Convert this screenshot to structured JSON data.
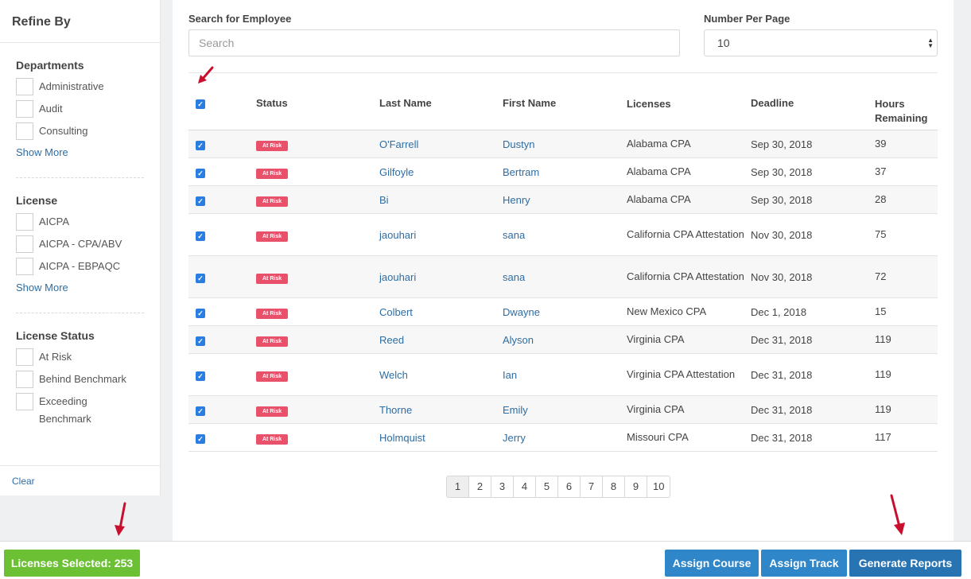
{
  "sidebar": {
    "title": "Refine By",
    "departments": {
      "title": "Departments",
      "options": [
        "Administrative",
        "Audit",
        "Consulting"
      ],
      "show_more": "Show More"
    },
    "license": {
      "title": "License",
      "options": [
        "AICPA",
        "AICPA - CPA/ABV",
        "AICPA - EBPAQC"
      ],
      "show_more": "Show More"
    },
    "license_status": {
      "title": "License Status",
      "options": [
        "At Risk",
        "Behind Benchmark",
        "Exceeding Benchmark"
      ]
    },
    "clear": "Clear"
  },
  "search": {
    "label": "Search for Employee",
    "placeholder": "Search",
    "value": ""
  },
  "per_page": {
    "label": "Number Per Page",
    "value": "10"
  },
  "table": {
    "headers": {
      "status": "Status",
      "last_name": "Last Name",
      "first_name": "First Name",
      "licenses": "Licenses",
      "deadline": "Deadline",
      "hours": "Hours Remaining"
    },
    "rows": [
      {
        "status": "At Risk",
        "last": "O'Farrell",
        "first": "Dustyn",
        "license": "Alabama CPA",
        "deadline": "Sep 30, 2018",
        "hours": "39"
      },
      {
        "status": "At Risk",
        "last": "Gilfoyle",
        "first": "Bertram",
        "license": "Alabama CPA",
        "deadline": "Sep 30, 2018",
        "hours": "37"
      },
      {
        "status": "At Risk",
        "last": "Bi",
        "first": "Henry",
        "license": "Alabama CPA",
        "deadline": "Sep 30, 2018",
        "hours": "28"
      },
      {
        "status": "At Risk",
        "last": "jaouhari",
        "first": "sana",
        "license": "California CPA Attestation",
        "deadline": "Nov 30, 2018",
        "hours": "75"
      },
      {
        "status": "At Risk",
        "last": "jaouhari",
        "first": "sana",
        "license": "California CPA Attestation",
        "deadline": "Nov 30, 2018",
        "hours": "72"
      },
      {
        "status": "At Risk",
        "last": "Colbert",
        "first": "Dwayne",
        "license": "New Mexico CPA",
        "deadline": "Dec 1, 2018",
        "hours": "15"
      },
      {
        "status": "At Risk",
        "last": "Reed",
        "first": "Alyson",
        "license": "Virginia CPA",
        "deadline": "Dec 31, 2018",
        "hours": "119"
      },
      {
        "status": "At Risk",
        "last": "Welch",
        "first": "Ian",
        "license": "Virginia CPA Attestation",
        "deadline": "Dec 31, 2018",
        "hours": "119"
      },
      {
        "status": "At Risk",
        "last": "Thorne",
        "first": "Emily",
        "license": "Virginia CPA",
        "deadline": "Dec 31, 2018",
        "hours": "119"
      },
      {
        "status": "At Risk",
        "last": "Holmquist",
        "first": "Jerry",
        "license": "Missouri CPA",
        "deadline": "Dec 31, 2018",
        "hours": "117"
      }
    ]
  },
  "pagination": {
    "pages": [
      "1",
      "2",
      "3",
      "4",
      "5",
      "6",
      "7",
      "8",
      "9",
      "10"
    ],
    "active": "1"
  },
  "footer": {
    "selected": "Licenses Selected: 253",
    "assign_course": "Assign Course",
    "assign_track": "Assign Track",
    "generate_reports": "Generate Reports"
  },
  "colors": {
    "accent_blue": "#2f86c8",
    "selected_green": "#6cc034",
    "at_risk_red": "#e9506a",
    "annotation_arrow": "#c8102e"
  },
  "icons": {
    "checkbox_checked": "check-icon",
    "select_arrows": "updown-icon",
    "annotation": "red-arrow-icon"
  }
}
